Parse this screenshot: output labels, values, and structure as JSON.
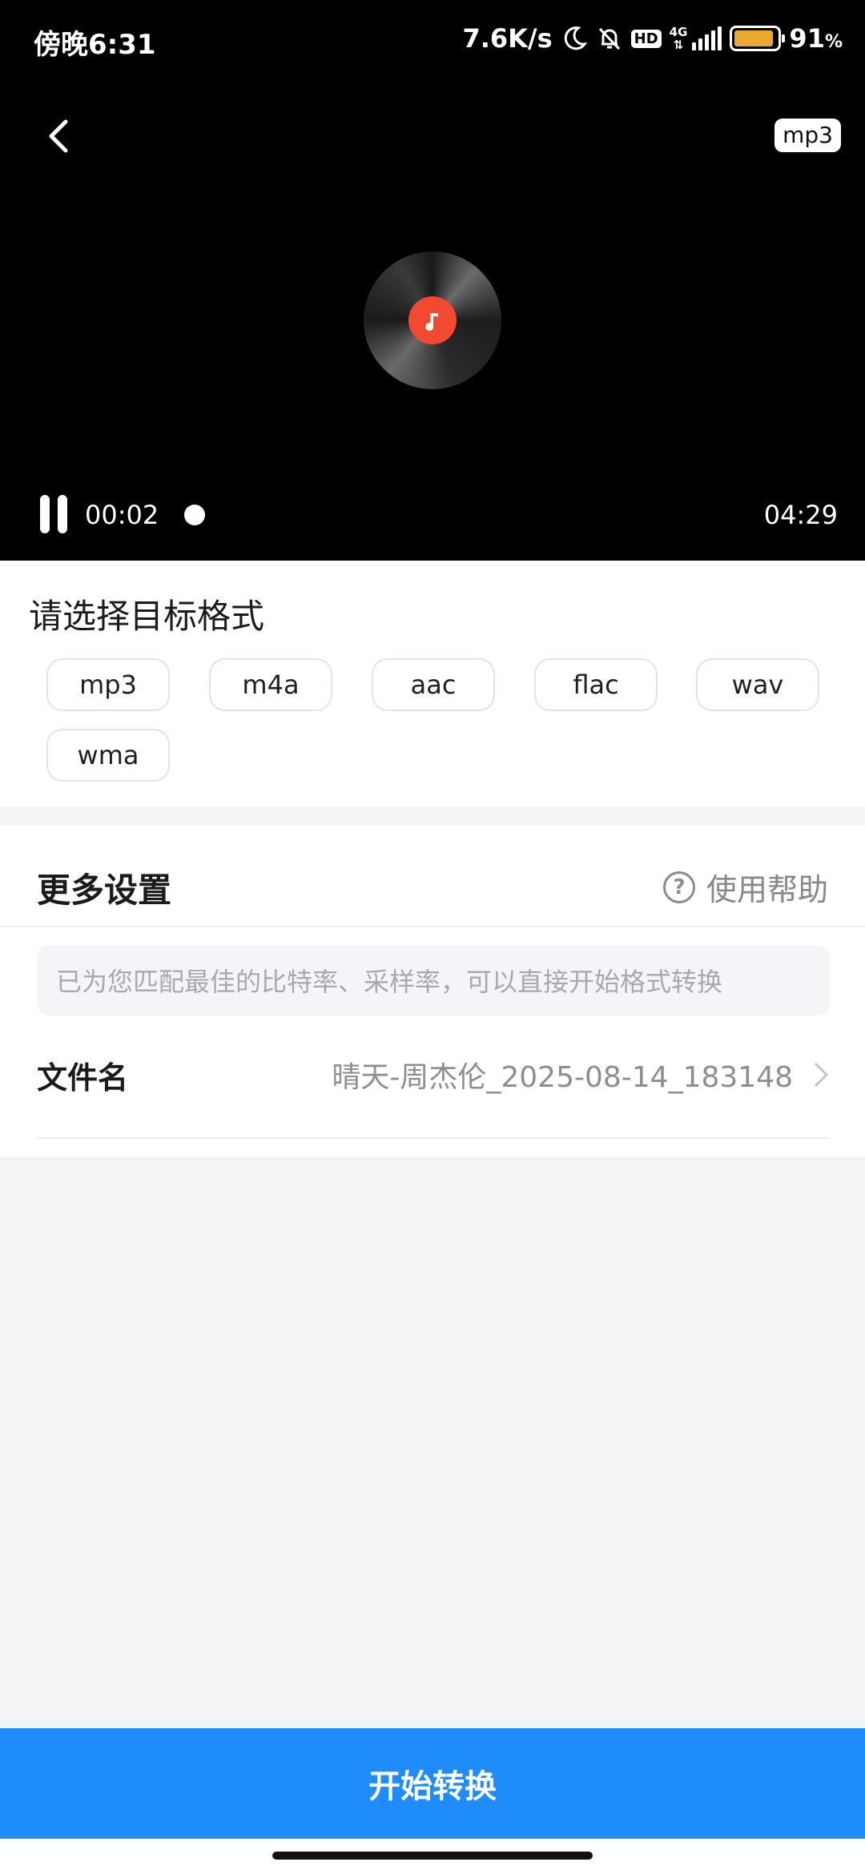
{
  "status_bar": {
    "time": "傍晚6:31",
    "net_speed": "7.6K/s",
    "hd_label": "HD",
    "network_type": "4G",
    "battery_percent": "91",
    "battery_percent_unit": "%",
    "battery_level": 0.91,
    "icons": [
      "moon-icon",
      "bell-muted-icon",
      "signal-icon",
      "battery-icon"
    ]
  },
  "player": {
    "format_badge": "mp3",
    "current_time": "00:02",
    "total_time": "04:29",
    "state": "playing",
    "accent_color": "#f24a30"
  },
  "format_section": {
    "title": "请选择目标格式",
    "options": [
      "mp3",
      "m4a",
      "aac",
      "flac",
      "wav",
      "wma"
    ]
  },
  "settings": {
    "title": "更多设置",
    "help_label": "使用帮助",
    "hint": "已为您匹配最佳的比特率、采样率，可以直接开始格式转换",
    "filename_label": "文件名",
    "filename_value": "晴天-周杰伦_2025-08-14_183148"
  },
  "action": {
    "convert_label": "开始转换",
    "color": "#1e8cfa"
  }
}
